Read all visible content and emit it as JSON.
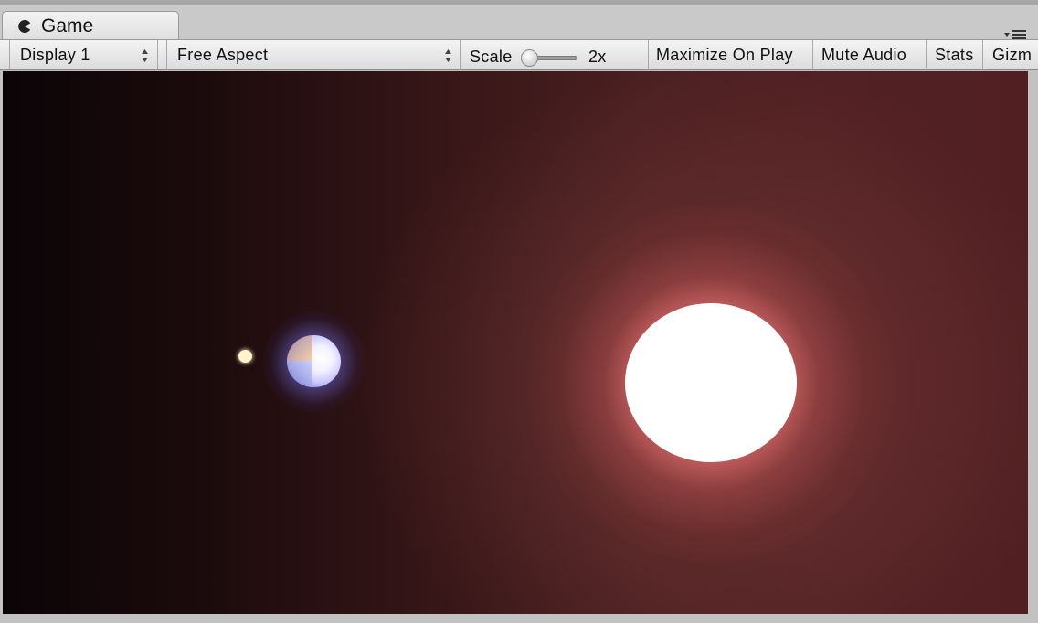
{
  "window": {
    "tab_title": "Game",
    "tab_icon": "pacman-game-icon",
    "menu_icon": "dropdown-menu-icon"
  },
  "toolbar": {
    "display_select": "Display 1",
    "aspect_select": "Free Aspect",
    "scale_label": "Scale",
    "scale_value": "2x",
    "scale_level": 0.0,
    "maximize_on_play": "Maximize On Play",
    "mute_audio": "Mute Audio",
    "stats": "Stats",
    "gizmos_partial": "Gizm"
  },
  "scene": {
    "background_left": "#0b0407",
    "background_right": "#511f22",
    "objects": [
      {
        "name": "sun",
        "color": "#ffffff",
        "glow": "#ff9a9a"
      },
      {
        "name": "planet",
        "color": "#e6e4ff",
        "glow": "#8a8aff"
      },
      {
        "name": "moon",
        "color": "#fff4cf"
      }
    ]
  }
}
